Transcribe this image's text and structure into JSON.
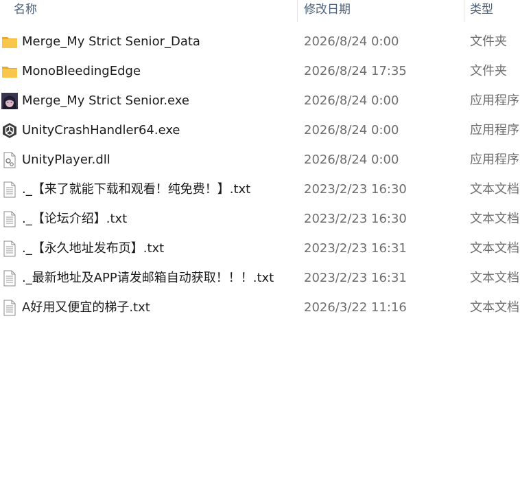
{
  "columns": {
    "name": "名称",
    "date": "修改日期",
    "type": "类型"
  },
  "files": [
    {
      "name": "Merge_My Strict Senior_Data",
      "date": "2026/8/24 0:00",
      "type": "文件夹",
      "icon": "folder-icon"
    },
    {
      "name": "MonoBleedingEdge",
      "date": "2026/8/24 17:35",
      "type": "文件夹",
      "icon": "folder-icon"
    },
    {
      "name": "Merge_My Strict Senior.exe",
      "date": "2026/8/24 0:00",
      "type": "应用程序",
      "icon": "game-exe-icon"
    },
    {
      "name": "UnityCrashHandler64.exe",
      "date": "2026/8/24 0:00",
      "type": "应用程序",
      "icon": "unity-logo-icon"
    },
    {
      "name": "UnityPlayer.dll",
      "date": "2026/8/24 0:00",
      "type": "应用程序",
      "icon": "dll-file-icon"
    },
    {
      "name": "._【来了就能下载和观看！纯免费！】.txt",
      "date": "2023/2/23 16:30",
      "type": "文本文档",
      "icon": "text-file-icon"
    },
    {
      "name": "._【论坛介绍】.txt",
      "date": "2023/2/23 16:30",
      "type": "文本文档",
      "icon": "text-file-icon"
    },
    {
      "name": "._【永久地址发布页】.txt",
      "date": "2023/2/23 16:31",
      "type": "文本文档",
      "icon": "text-file-icon"
    },
    {
      "name": "._最新地址及APP请发邮箱自动获取！！！.txt",
      "date": "2023/2/23 16:31",
      "type": "文本文档",
      "icon": "text-file-icon"
    },
    {
      "name": "A好用又便宜的梯子.txt",
      "date": "2026/3/22 11:16",
      "type": "文本文档",
      "icon": "text-file-icon"
    }
  ],
  "colors": {
    "header_text": "#4c607a",
    "name_text": "#1b1b1b",
    "meta_text": "#6d6d6d",
    "folder": "#f8c64a"
  }
}
